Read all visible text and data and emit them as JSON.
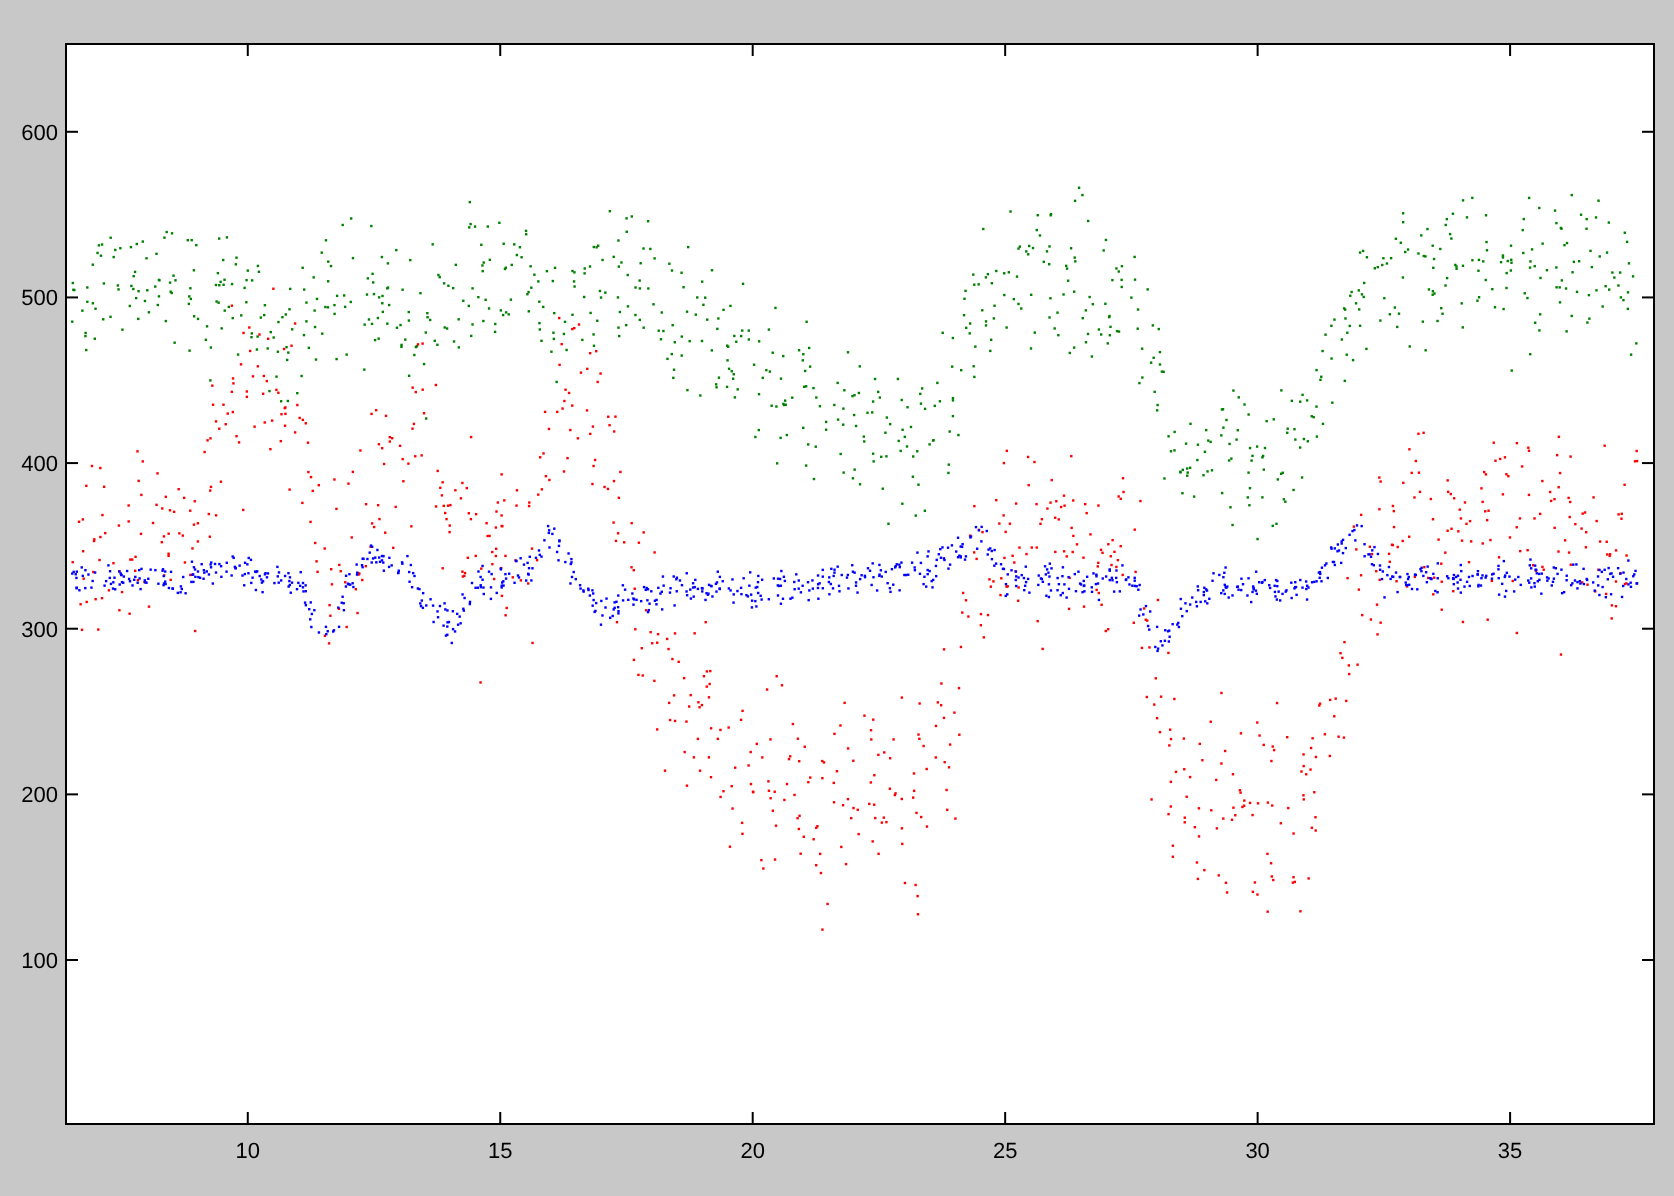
{
  "figure": {
    "x_tick_labels": [
      "10",
      "15",
      "20",
      "25",
      "30",
      "35"
    ],
    "y_tick_labels": [
      "600",
      "500",
      "400",
      "300",
      "200",
      "100"
    ]
  }
}
